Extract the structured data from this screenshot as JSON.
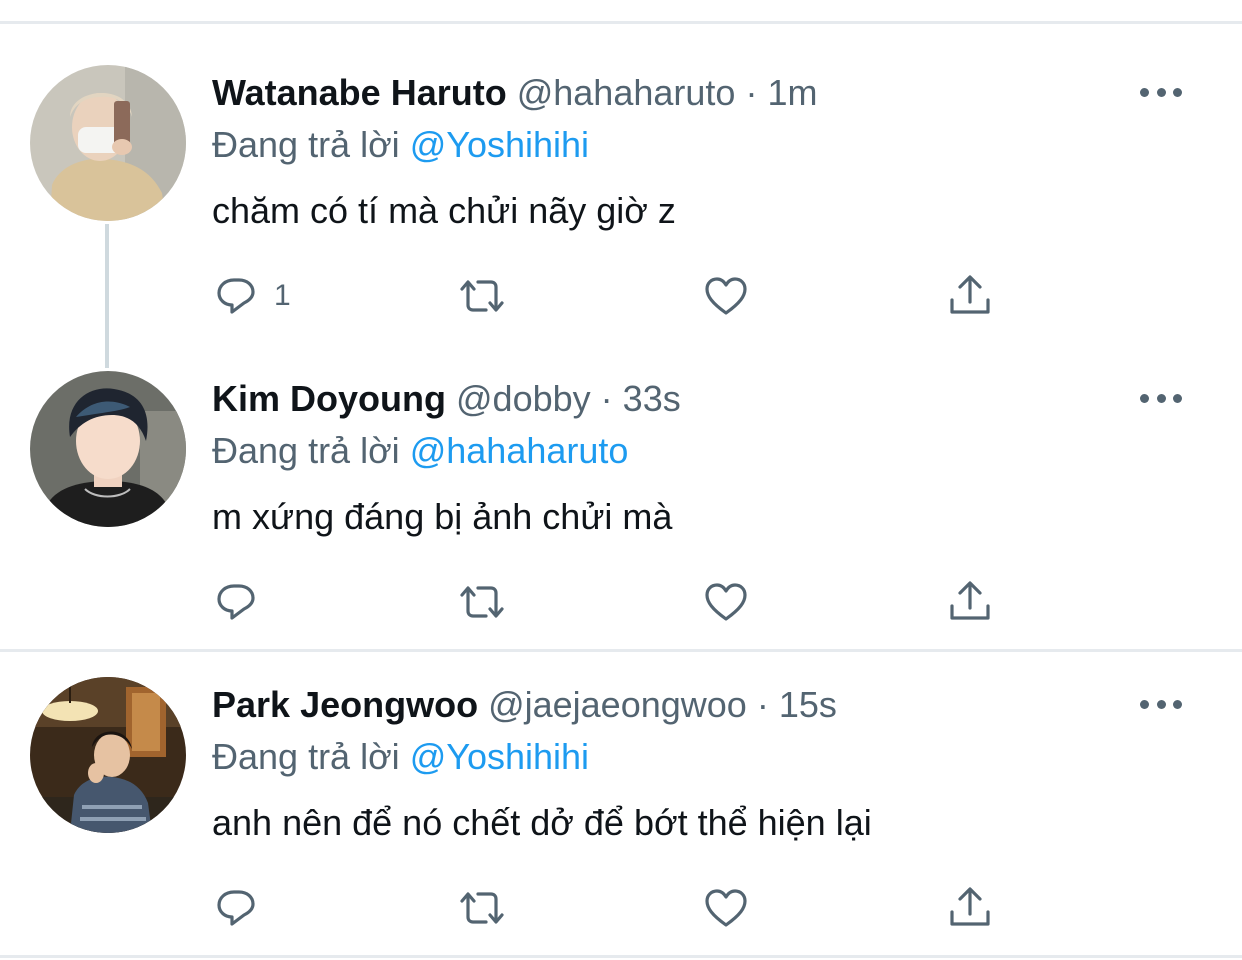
{
  "colors": {
    "accent": "#1d9bf0",
    "secondary_text": "#536471",
    "primary_text": "#0f1419",
    "divider": "#e6eaee"
  },
  "tweets": [
    {
      "name": "Watanabe Haruto",
      "handle": "@hahaharuto",
      "separator": "·",
      "time": "1m",
      "reply_prefix": "Đang trả lời",
      "reply_to": "@Yoshihihi",
      "text": "chăm có tí mà chửi nãy giờ z",
      "reply_count": "1",
      "icons": [
        "reply-icon",
        "retweet-icon",
        "like-icon",
        "share-icon",
        "more-icon"
      ]
    },
    {
      "name": "Kim Doyoung",
      "handle": "@dobby",
      "separator": "·",
      "time": "33s",
      "reply_prefix": "Đang trả lời",
      "reply_to": "@hahaharuto",
      "text": "m xứng đáng bị ảnh chửi mà",
      "reply_count": "",
      "icons": [
        "reply-icon",
        "retweet-icon",
        "like-icon",
        "share-icon",
        "more-icon"
      ]
    },
    {
      "name": "Park Jeongwoo",
      "handle": "@jaejaeongwoo",
      "separator": "·",
      "time": "15s",
      "reply_prefix": "Đang trả lời",
      "reply_to": "@Yoshihihi",
      "text": "anh nên để nó chết dở để bớt thể hiện lại",
      "reply_count": "",
      "icons": [
        "reply-icon",
        "retweet-icon",
        "like-icon",
        "share-icon",
        "more-icon"
      ]
    }
  ]
}
